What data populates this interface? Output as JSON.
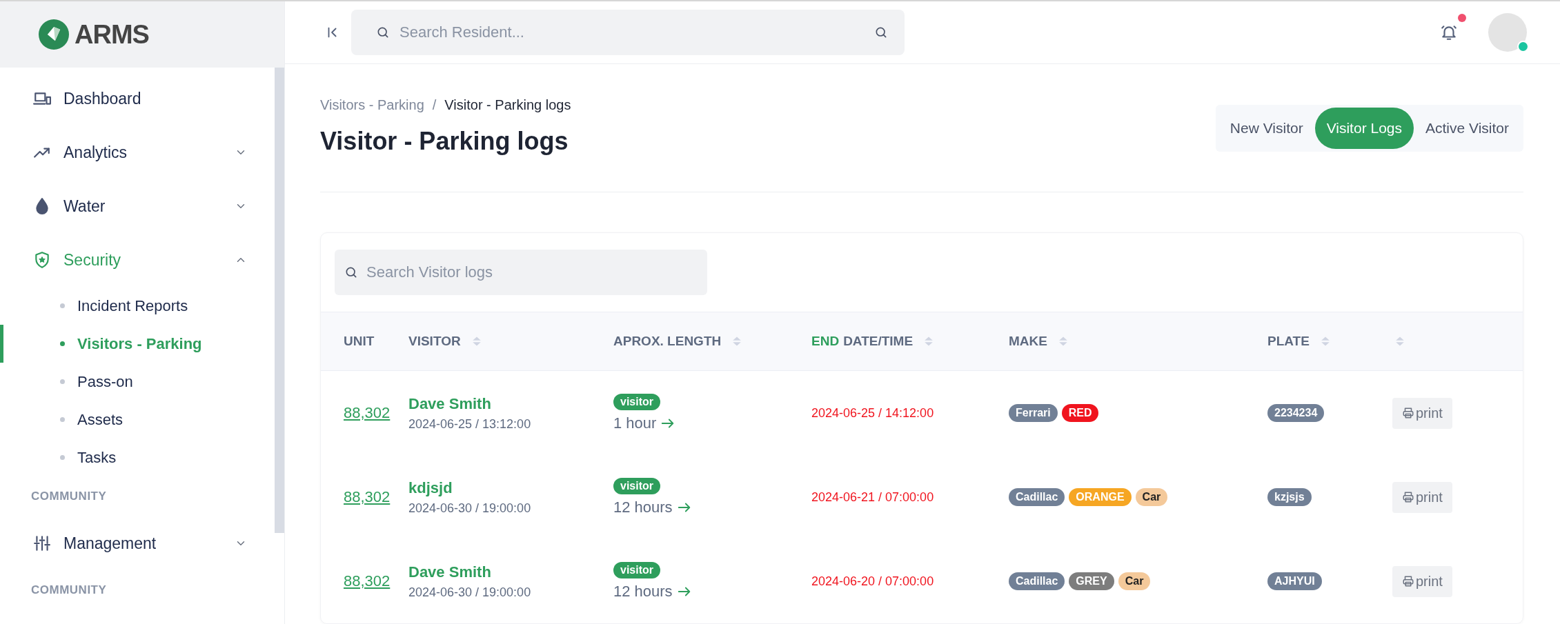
{
  "brand": {
    "name": "ARMS"
  },
  "sidebar": {
    "items": [
      {
        "kind": "item",
        "label": "Dashboard",
        "selected": false
      },
      {
        "kind": "item",
        "label": "Analytics",
        "selected": false,
        "expanded": false
      },
      {
        "kind": "item",
        "label": "Water",
        "selected": false,
        "expanded": false
      },
      {
        "kind": "item",
        "label": "Security",
        "selected": true,
        "expanded": true,
        "children": [
          {
            "label": "Incident Reports",
            "selected": false
          },
          {
            "label": "Visitors - Parking",
            "selected": true
          },
          {
            "label": "Pass-on",
            "selected": false
          },
          {
            "label": "Assets",
            "selected": false
          },
          {
            "label": "Tasks",
            "selected": false
          }
        ]
      },
      {
        "kind": "section",
        "label": "COMMUNITY"
      },
      {
        "kind": "item",
        "label": "Management",
        "selected": false,
        "expanded": false
      },
      {
        "kind": "section",
        "label": "COMMUNITY"
      }
    ]
  },
  "header": {
    "search": {
      "placeholder": "Search Resident..."
    },
    "notifications": {
      "unread": true
    },
    "avatar": {
      "online": true
    }
  },
  "page": {
    "breadcrumb": {
      "separator": "/",
      "items": [
        "Visitors - Parking",
        "Visitor - Parking logs"
      ]
    },
    "title": "Visitor - Parking logs",
    "tabs": [
      {
        "label": "New Visitor",
        "selected": false
      },
      {
        "label": "Visitor Logs",
        "selected": true
      },
      {
        "label": "Active Visitor",
        "selected": false
      }
    ]
  },
  "table": {
    "search": {
      "placeholder": "Search Visitor logs"
    },
    "columns": [
      {
        "label": "UNIT",
        "sortable": false
      },
      {
        "label": "VISITOR",
        "sortable": true
      },
      {
        "label": "APROX. LENGTH",
        "sortable": true
      },
      {
        "highlight": "END",
        "label": "DATE/TIME",
        "sortable": true
      },
      {
        "label": "MAKE",
        "sortable": true
      },
      {
        "label": "PLATE",
        "sortable": true
      },
      {
        "sortable": true
      }
    ],
    "rows": [
      {
        "unit": "88,302",
        "visitor": "Dave Smith",
        "visit_time": "2024-06-25 / 13:12:00",
        "type": "visitor",
        "length": "1 hour",
        "end": "2024-06-25 / 14:12:00",
        "make": [
          {
            "text": "Ferrari",
            "color": "#718096"
          },
          {
            "text": "RED",
            "color": "#f0141e"
          }
        ],
        "plate": "2234234",
        "action": "print"
      },
      {
        "unit": "88,302",
        "visitor": "kdjsjd",
        "visit_time": "2024-06-30 / 19:00:00",
        "type": "visitor",
        "length": "12 hours",
        "end": "2024-06-21 / 07:00:00",
        "make": [
          {
            "text": "Cadillac",
            "color": "#718096"
          },
          {
            "text": "ORANGE",
            "color": "#f6a623"
          },
          {
            "text": "Car",
            "color": "#f4c99a"
          }
        ],
        "plate": "kzjsjs",
        "action": "print"
      },
      {
        "unit": "88,302",
        "visitor": "Dave Smith",
        "visit_time": "2024-06-30 / 19:00:00",
        "type": "visitor",
        "length": "12 hours",
        "end": "2024-06-20 / 07:00:00",
        "make": [
          {
            "text": "Cadillac",
            "color": "#718096"
          },
          {
            "text": "GREY",
            "color": "#7d7d7d"
          },
          {
            "text": "Car",
            "color": "#f4c99a"
          }
        ],
        "plate": "AJHYUI",
        "action": "print"
      }
    ]
  }
}
